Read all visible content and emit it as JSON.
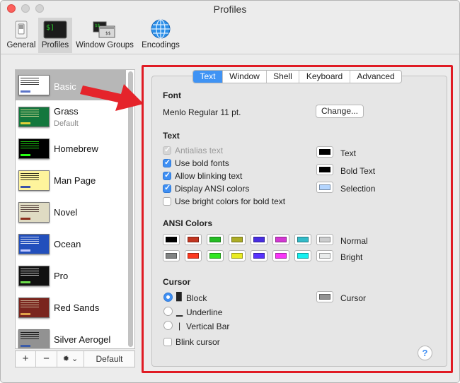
{
  "window": {
    "title": "Profiles"
  },
  "toolbar": {
    "items": [
      {
        "label": "General",
        "icon": "switch-icon"
      },
      {
        "label": "Profiles",
        "icon": "terminal-icon"
      },
      {
        "label": "Window Groups",
        "icon": "window-groups-icon"
      },
      {
        "label": "Encodings",
        "icon": "globe-icon"
      }
    ],
    "selected": "Profiles"
  },
  "profiles": [
    {
      "name": "Basic",
      "subtitle": "",
      "bg": "#ffffff",
      "text": "#000000",
      "accent": "#5b74c8"
    },
    {
      "name": "Grass",
      "subtitle": "Default",
      "bg": "#13773d",
      "text": "#fff0a5",
      "accent": "#e0d03a"
    },
    {
      "name": "Homebrew",
      "subtitle": "",
      "bg": "#000000",
      "text": "#28fe14",
      "accent": "#28fe14"
    },
    {
      "name": "Man Page",
      "subtitle": "",
      "bg": "#fef49c",
      "text": "#000000",
      "accent": "#3c54a8"
    },
    {
      "name": "Novel",
      "subtitle": "",
      "bg": "#dfdbc3",
      "text": "#3b2322",
      "accent": "#8b2f1e"
    },
    {
      "name": "Ocean",
      "subtitle": "",
      "bg": "#224fbc",
      "text": "#ffffff",
      "accent": "#c0c8ff"
    },
    {
      "name": "Pro",
      "subtitle": "",
      "bg": "#111111",
      "text": "#f2f2f2",
      "accent": "#6bdc4a"
    },
    {
      "name": "Red Sands",
      "subtitle": "",
      "bg": "#7a251e",
      "text": "#d7c9a7",
      "accent": "#e0a24a"
    },
    {
      "name": "Silver Aerogel",
      "subtitle": "",
      "bg": "#929292",
      "text": "#000000",
      "accent": "#3c5ca8"
    }
  ],
  "sidebar_footer": {
    "add": "+",
    "remove": "−",
    "gear": "✹ ⌄",
    "default_label": "Default"
  },
  "tabs": [
    "Text",
    "Window",
    "Shell",
    "Keyboard",
    "Advanced"
  ],
  "active_tab": "Text",
  "font": {
    "section": "Font",
    "value": "Menlo Regular 11 pt.",
    "change_label": "Change..."
  },
  "text": {
    "section": "Text",
    "options": [
      {
        "label": "Antialias text",
        "checked": true,
        "disabled": true
      },
      {
        "label": "Use bold fonts",
        "checked": true,
        "disabled": false
      },
      {
        "label": "Allow blinking text",
        "checked": true,
        "disabled": false
      },
      {
        "label": "Display ANSI colors",
        "checked": true,
        "disabled": false
      },
      {
        "label": "Use bright colors for bold text",
        "checked": false,
        "disabled": false
      }
    ],
    "colors": [
      {
        "label": "Text",
        "color": "#000000"
      },
      {
        "label": "Bold Text",
        "color": "#000000"
      },
      {
        "label": "Selection",
        "color": "#b4d5fe"
      }
    ]
  },
  "ansi": {
    "section": "ANSI Colors",
    "normal_label": "Normal",
    "bright_label": "Bright",
    "normal": [
      "#000000",
      "#c23621",
      "#25bc24",
      "#adad27",
      "#492ee1",
      "#d338d3",
      "#33bbc8",
      "#cbcccd"
    ],
    "bright": [
      "#818383",
      "#fc391f",
      "#31e722",
      "#eaec23",
      "#5833ff",
      "#f935f8",
      "#14f0f0",
      "#e9ebeb"
    ]
  },
  "cursor": {
    "section": "Cursor",
    "options": [
      {
        "glyph": "█",
        "label": "Block",
        "selected": true
      },
      {
        "glyph": "▁",
        "label": "Underline",
        "selected": false
      },
      {
        "glyph": "|",
        "label": "Vertical Bar",
        "selected": false
      }
    ],
    "blink_label": "Blink cursor",
    "blink_checked": false,
    "color_label": "Cursor",
    "color": "#929292"
  },
  "help": "?"
}
